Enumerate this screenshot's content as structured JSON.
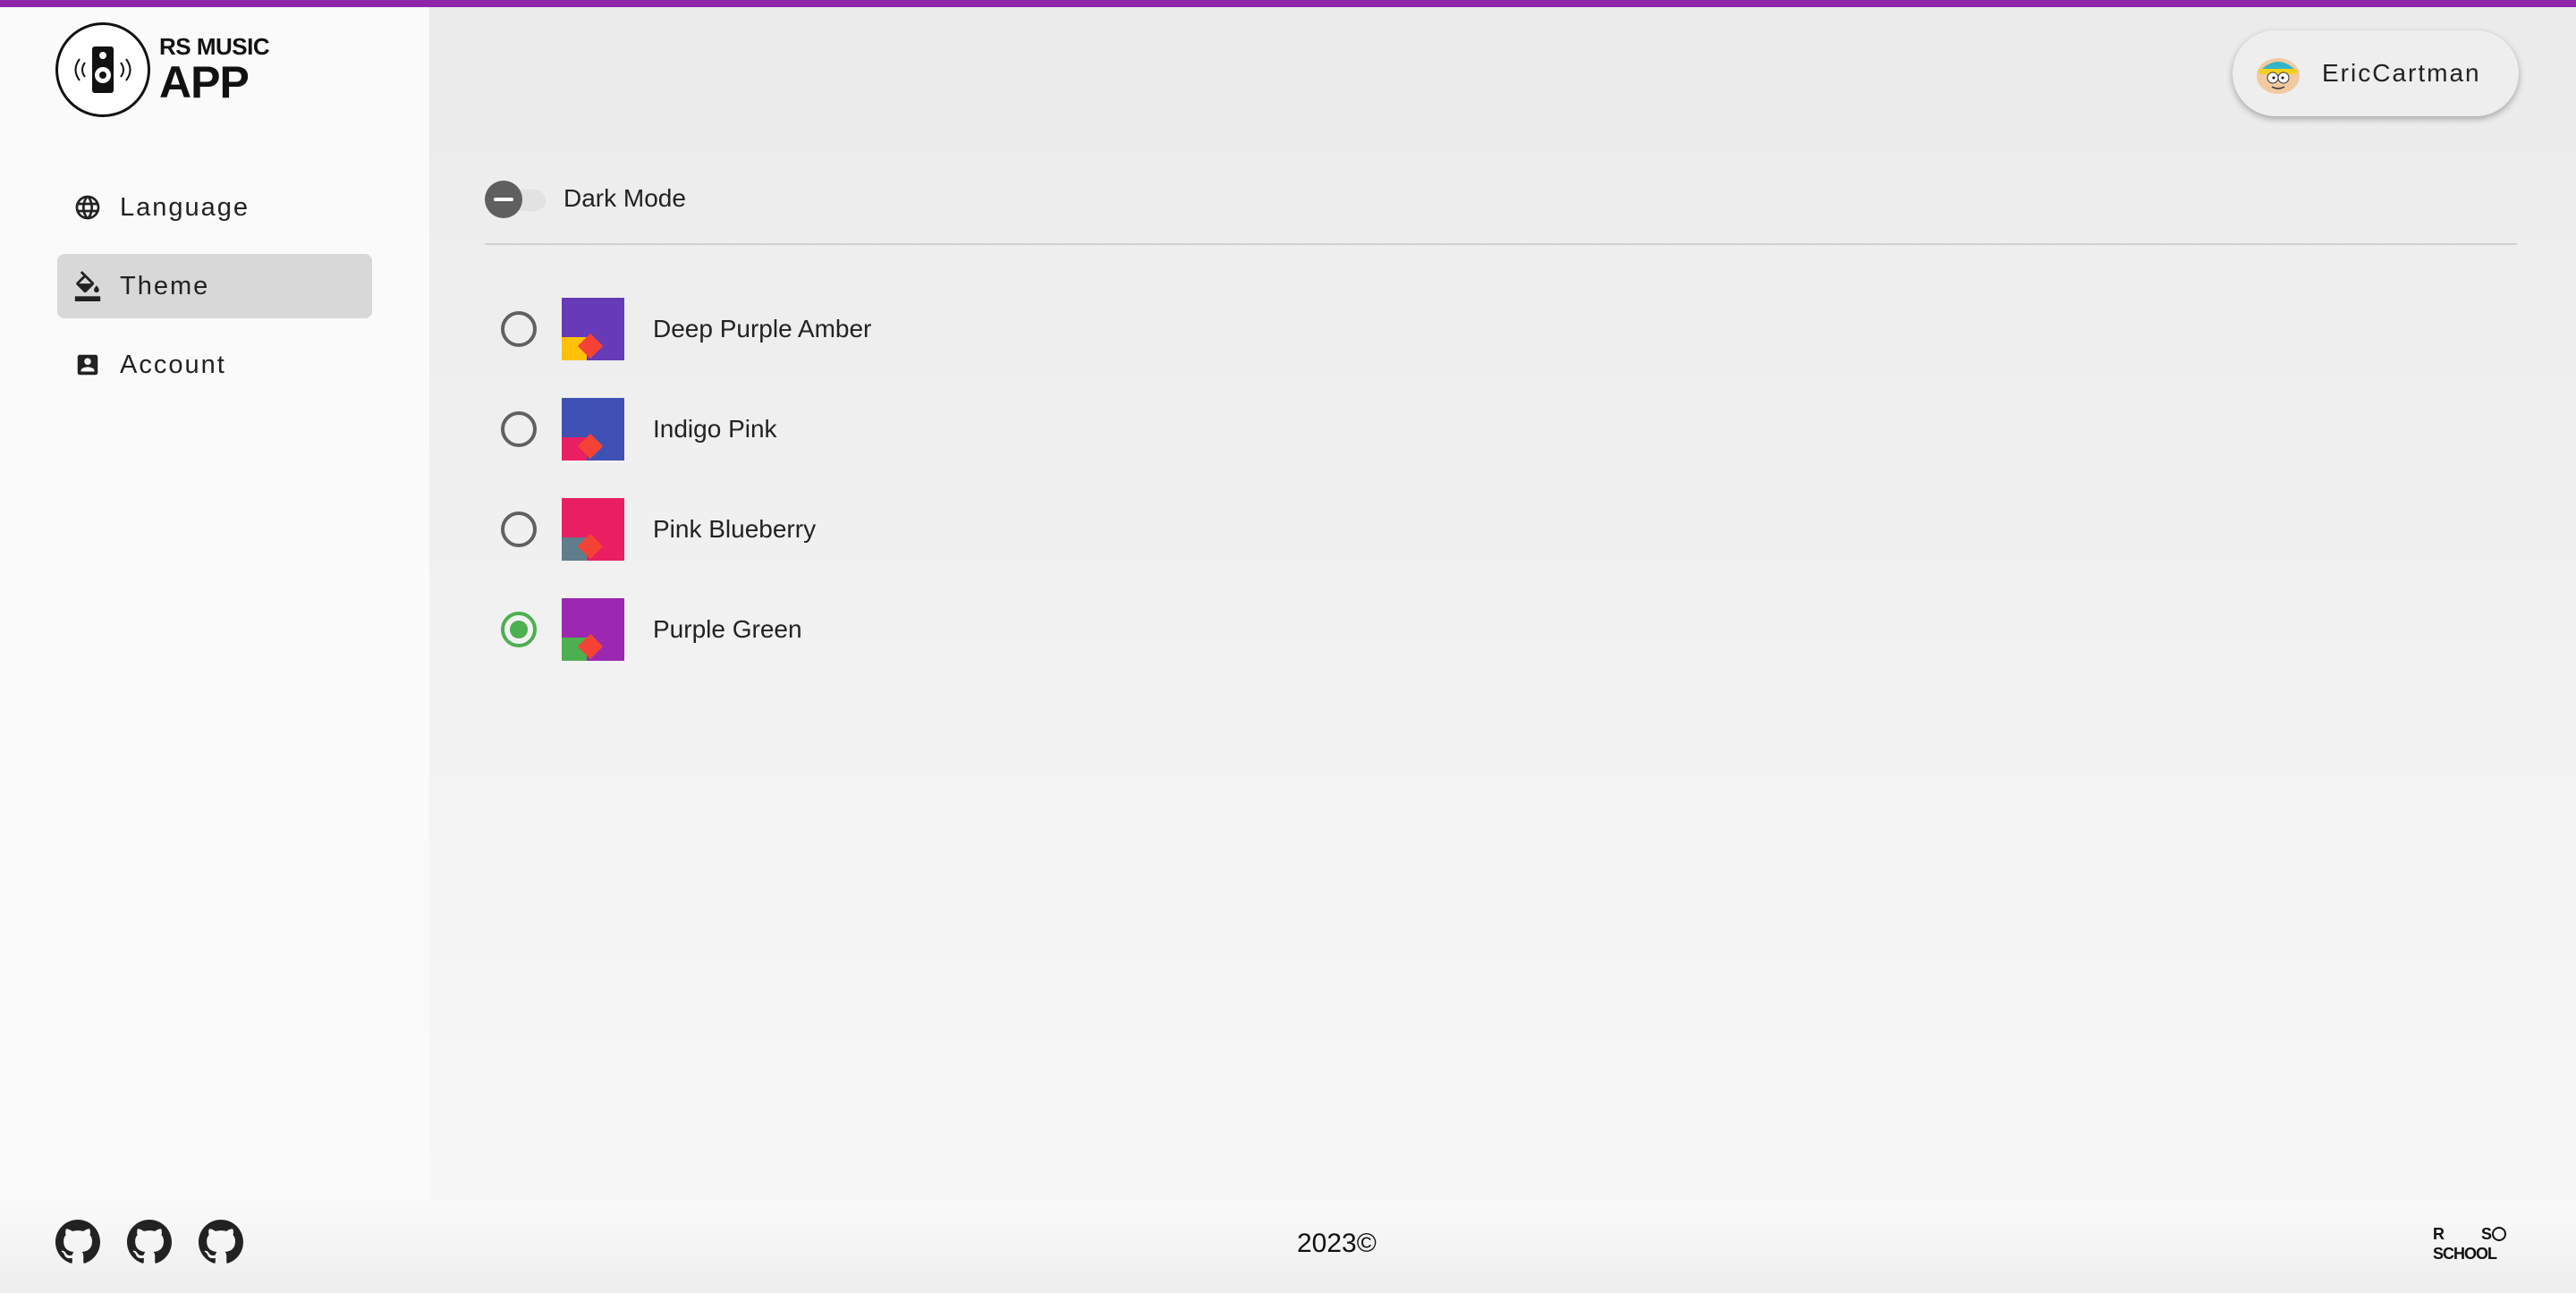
{
  "app": {
    "logo_small": "RS MUSIC",
    "logo_big": "APP"
  },
  "sidebar": {
    "items": [
      {
        "label": "Language",
        "icon": "globe-icon",
        "active": false
      },
      {
        "label": "Theme",
        "icon": "paint-bucket-icon",
        "active": true
      },
      {
        "label": "Account",
        "icon": "account-box-icon",
        "active": false
      }
    ]
  },
  "header": {
    "username": "EricCartman",
    "avatar_icon": "avatar-icon"
  },
  "settings": {
    "dark_mode_label": "Dark Mode",
    "dark_mode_enabled": false,
    "themes": [
      {
        "label": "Deep Purple Amber",
        "primary": "#673ab7",
        "accent": "#ffc107",
        "warn": "#f44336",
        "selected": false
      },
      {
        "label": "Indigo Pink",
        "primary": "#3f51b5",
        "accent": "#e91e63",
        "warn": "#f44336",
        "selected": false
      },
      {
        "label": "Pink Blueberry",
        "primary": "#e91e63",
        "accent": "#607d8b",
        "warn": "#f44336",
        "selected": false
      },
      {
        "label": "Purple Green",
        "primary": "#9c27b0",
        "accent": "#4caf50",
        "warn": "#f44336",
        "selected": true
      }
    ]
  },
  "footer": {
    "copyright": "2023©",
    "github_links": [
      "github-icon",
      "github-icon",
      "github-icon"
    ],
    "school_logo": "RS SCHOOL"
  },
  "colors": {
    "top_bar": "#8e24aa",
    "selected_radio": "#4caf50"
  }
}
